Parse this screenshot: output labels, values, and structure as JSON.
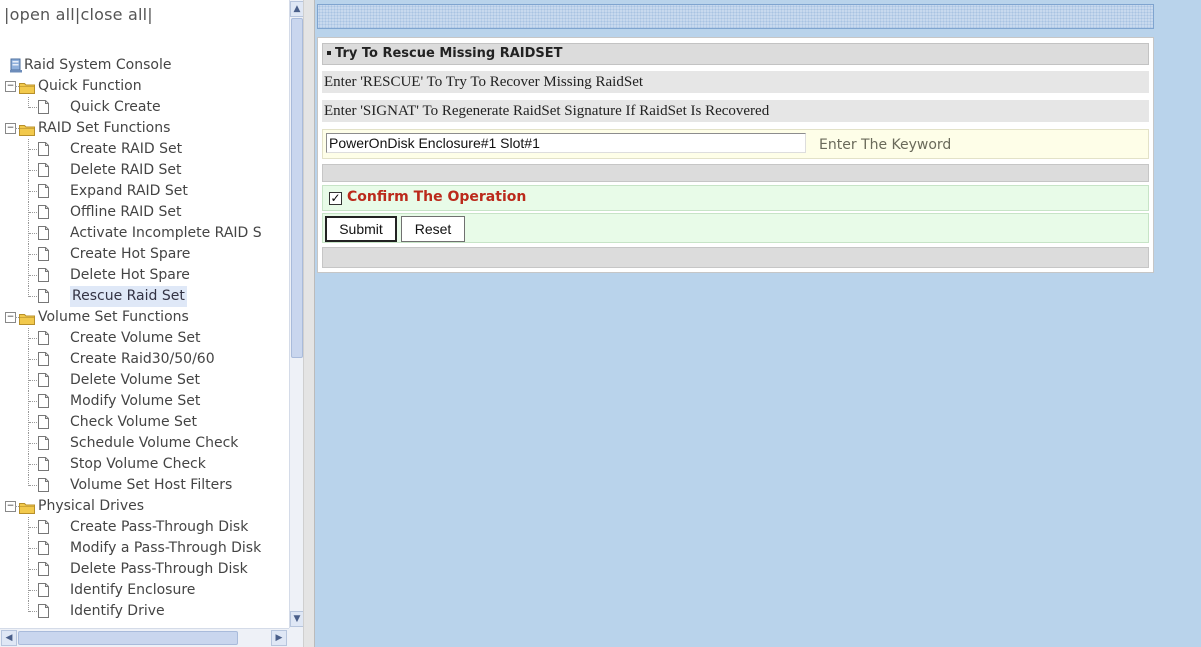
{
  "nav": {
    "open_all": "open all",
    "close_all": "close all",
    "open_close_prefix": "|",
    "open_close_sep": "|",
    "open_close_suffix": "|",
    "root": "Raid System Console",
    "groups": [
      {
        "label": "Quick Function",
        "items": [
          "Quick Create"
        ]
      },
      {
        "label": "RAID Set Functions",
        "items": [
          "Create RAID Set",
          "Delete RAID Set",
          "Expand RAID Set",
          "Offline RAID Set",
          "Activate Incomplete RAID S",
          "Create Hot Spare",
          "Delete Hot Spare",
          "Rescue Raid Set"
        ]
      },
      {
        "label": "Volume Set Functions",
        "items": [
          "Create Volume Set",
          "Create Raid30/50/60",
          "Delete Volume Set",
          "Modify Volume Set",
          "Check Volume Set",
          "Schedule Volume Check",
          "Stop Volume Check",
          "Volume Set Host Filters"
        ]
      },
      {
        "label": "Physical Drives",
        "items": [
          "Create Pass-Through Disk",
          "Modify a Pass-Through Disk",
          "Delete Pass-Through Disk",
          "Identify Enclosure",
          "Identify Drive"
        ]
      }
    ],
    "selected": "Rescue Raid Set"
  },
  "form": {
    "title": "Try To Rescue Missing RAIDSET",
    "rescue_hint": "Enter 'RESCUE' To Try To Recover Missing RaidSet",
    "signat_hint": "Enter 'SIGNAT' To Regenerate RaidSet Signature If RaidSet Is Recovered",
    "keyword_value": "PowerOnDisk Enclosure#1 Slot#1",
    "keyword_label": "Enter The Keyword",
    "confirm_checked": true,
    "confirm_label": "Confirm The Operation",
    "submit_label": "Submit",
    "reset_label": "Reset"
  },
  "colors": {
    "page_bg": "#b9d3eb",
    "confirm_text": "#bb2a1c",
    "folder": "#f2c94c"
  }
}
